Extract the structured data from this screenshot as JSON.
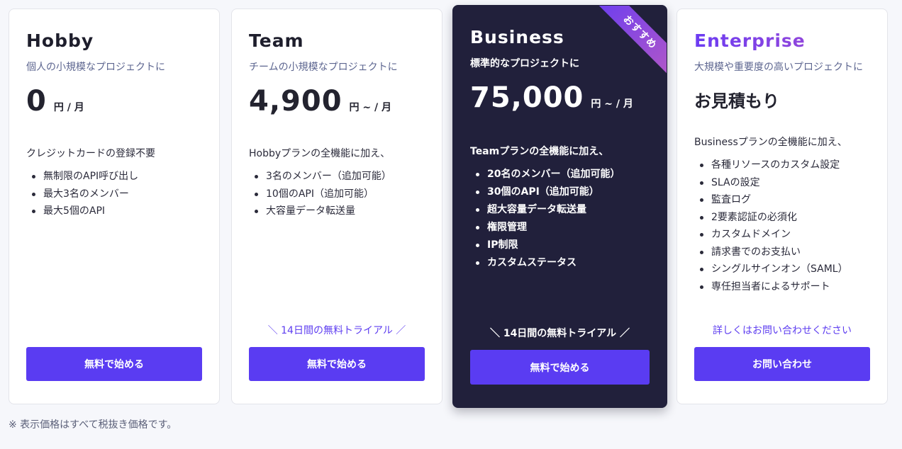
{
  "plans": [
    {
      "name": "Hobby",
      "description": "個人の小規模なプロジェクトに",
      "price": "0",
      "price_unit": "円 / 月",
      "intro": "クレジットカードの登録不要",
      "features": [
        "無制限のAPI呼び出し",
        "最大3名のメンバー",
        "最大5個のAPI"
      ],
      "note": "",
      "cta": "無料で始める"
    },
    {
      "name": "Team",
      "description": "チームの小規模なプロジェクトに",
      "price": "4,900",
      "price_unit": "円 ~ / 月",
      "intro": "Hobbyプランの全機能に加え、",
      "features": [
        "3名のメンバー（追加可能）",
        "10個のAPI（追加可能）",
        "大容量データ転送量"
      ],
      "note": "＼ 14日間の無料トライアル ／",
      "cta": "無料で始める"
    },
    {
      "name": "Business",
      "description": "標準的なプロジェクトに",
      "price": "75,000",
      "price_unit": "円 ~ / 月",
      "intro": "Teamプランの全機能に加え、",
      "features": [
        "20名のメンバー（追加可能）",
        "30個のAPI（追加可能）",
        "超大容量データ転送量",
        "権限管理",
        "IP制限",
        "カスタムステータス"
      ],
      "note": "＼ 14日間の無料トライアル ／",
      "cta": "無料で始める",
      "ribbon": "おすすめ"
    },
    {
      "name": "Enterprise",
      "description": "大規模や重要度の高いプロジェクトに",
      "price": "お見積もり",
      "price_unit": "",
      "intro": "Businessプランの全機能に加え、",
      "features": [
        "各種リソースのカスタム設定",
        "SLAの設定",
        "監査ログ",
        "2要素認証の必須化",
        "カスタムドメイン",
        "請求書でのお支払い",
        "シングルサインオン（SAML）",
        "専任担当者によるサポート"
      ],
      "note": "詳しくはお問い合わせください",
      "cta": "お問い合わせ"
    }
  ],
  "footnote": "※ 表示価格はすべて税抜き価格です。",
  "colors": {
    "accent": "#5a3cf2",
    "featured_bg": "#21203b",
    "page_bg": "#f6f7fb",
    "note_text": "#5e3ef0"
  }
}
